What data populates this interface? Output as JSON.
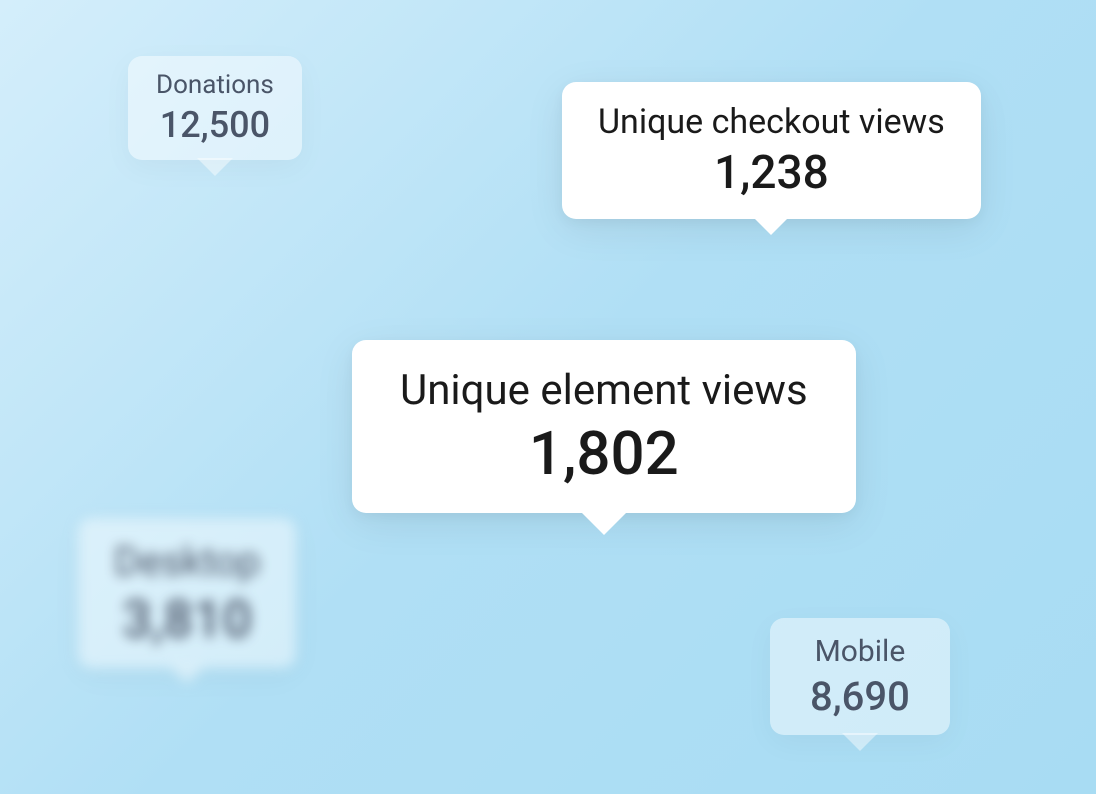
{
  "cards": {
    "donations": {
      "label": "Donations",
      "value": "12,500"
    },
    "checkout": {
      "label": "Unique checkout views",
      "value": "1,238"
    },
    "element": {
      "label": "Unique element views",
      "value": "1,802"
    },
    "desktop": {
      "label": "Desktop",
      "value": "3,810"
    },
    "mobile": {
      "label": "Mobile",
      "value": "8,690"
    }
  }
}
